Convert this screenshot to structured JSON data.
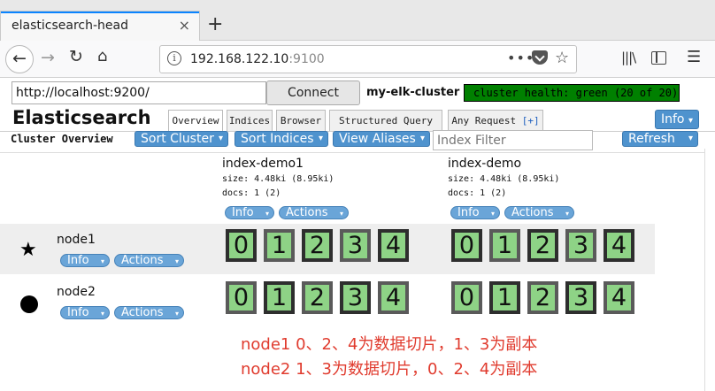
{
  "browser": {
    "tab_title": "elasticsearch-head",
    "tab_close": "×",
    "new_tab": "+",
    "url_host": "192.168.122.10",
    "url_port": ":9100",
    "url_dots": "•••",
    "icons": [
      "back-arrow-icon",
      "forward-arrow-icon",
      "reload-icon",
      "home-icon",
      "info-icon",
      "pocket-icon",
      "star-icon",
      "library-icon",
      "sidebar-icon",
      "hamburger-menu-icon"
    ]
  },
  "header": {
    "connect_url": "http://localhost:9200/",
    "connect_label": "Connect",
    "cluster_name": "my-elk-cluster",
    "health": "cluster health: green (20 of 20)",
    "health_color": "#008000",
    "title": "Elasticsearch",
    "tabs": [
      {
        "label": "Overview",
        "plus": ""
      },
      {
        "label": "Indices",
        "plus": ""
      },
      {
        "label": "Browser",
        "plus": ""
      },
      {
        "label": "Structured Query ",
        "plus": "[+]"
      },
      {
        "label": "Any Request ",
        "plus": "[+]"
      }
    ],
    "info_label": "Info"
  },
  "toolbar": {
    "overview_label": "Cluster Overview",
    "sort_cluster": "Sort Cluster",
    "sort_indices": "Sort Indices",
    "view_aliases": "View Aliases",
    "filter_placeholder": "Index Filter",
    "refresh": "Refresh",
    "caret": "▾"
  },
  "indices": [
    {
      "name": "index-demo1",
      "size": "size: 4.48ki (8.95ki)",
      "docs": "docs: 1 (2)",
      "info": "Info",
      "actions": "Actions"
    },
    {
      "name": "index-demo",
      "size": "size: 4.48ki (8.95ki)",
      "docs": "docs: 1 (2)",
      "info": "Info",
      "actions": "Actions"
    }
  ],
  "nodes": [
    {
      "name": "node1",
      "icon": "★",
      "info": "Info",
      "actions": "Actions",
      "shards": [
        "0",
        "1",
        "2",
        "3",
        "4"
      ]
    },
    {
      "name": "node2",
      "icon": "●",
      "info": "Info",
      "actions": "Actions",
      "shards": [
        "0",
        "1",
        "2",
        "3",
        "4"
      ]
    }
  ],
  "notes": [
    "node1 0、2、4为数据切片，1、3为副本",
    "node2 1、3为数据切片，0、2、4为副本"
  ],
  "colors": {
    "accent_blue": "#4f93ce",
    "shard_green": "#8ed386",
    "note_red": "#e03b2e"
  }
}
